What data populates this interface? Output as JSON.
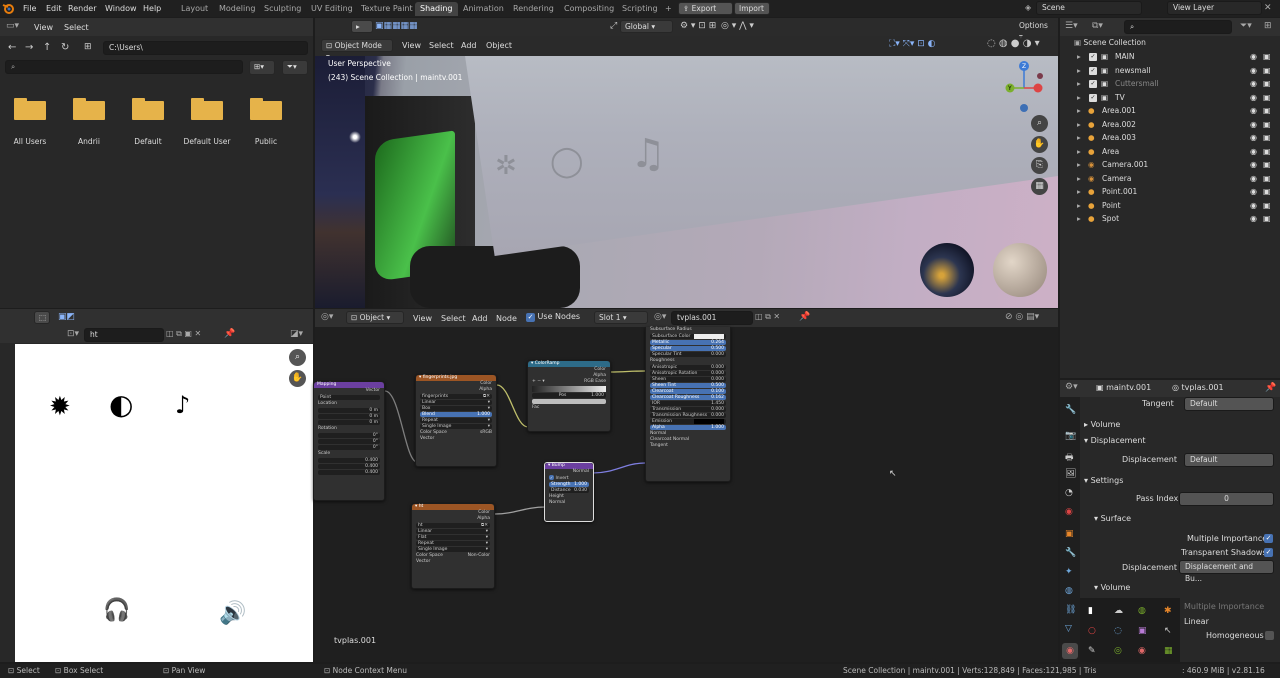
{
  "menubar": {
    "items": [
      "File",
      "Edit",
      "Render",
      "Window",
      "Help"
    ]
  },
  "workspaces": {
    "tabs": [
      "Layout",
      "Modeling",
      "Sculpting",
      "UV Editing",
      "Texture Paint",
      "Shading",
      "Animation",
      "Rendering",
      "Compositing",
      "Scripting"
    ],
    "active": "Shading"
  },
  "topright": {
    "export": "Export",
    "import": "Import",
    "scene": "Scene",
    "view_layer": "View Layer"
  },
  "file_browser": {
    "view": "View",
    "select": "Select",
    "path": "C:\\Users\\",
    "folders": [
      "All Users",
      "Andrii",
      "Default",
      "Default User",
      "Public"
    ],
    "folder_color": "#e6b34a"
  },
  "viewport": {
    "mode": "Object Mode",
    "menus": [
      "View",
      "Select",
      "Add",
      "Object"
    ],
    "orientation": "Global",
    "options": "Options",
    "overlay_title": "User Perspective",
    "overlay_subtitle": "(243) Scene Collection | maintv.001",
    "gizmo": {
      "x": "X",
      "y": "Y",
      "z": "Z"
    }
  },
  "image_editor": {
    "image_name": "ht"
  },
  "node_editor": {
    "type": "Object",
    "menus": [
      "View",
      "Select",
      "Add",
      "Node"
    ],
    "use_nodes": "Use Nodes",
    "slot": "Slot 1",
    "material": "tvplas.001",
    "footer": "tvplas.001",
    "nodes": {
      "img1": {
        "title": "fingerprints.jpg",
        "outs": [
          "Color",
          "Alpha"
        ],
        "fields": [
          "fingerprints",
          "Linear",
          "Box",
          "Blend",
          "Repeat",
          "Single Image",
          "Color Space",
          "sRGB",
          "Vector"
        ],
        "blend_val": "1.000"
      },
      "img2": {
        "title": "ht",
        "outs": [
          "Color",
          "Alpha"
        ],
        "fields": [
          "ht",
          "Linear",
          "Flat",
          "Repeat",
          "Single Image",
          "Color Space",
          "Non-Color",
          "Vector"
        ]
      },
      "colorramp": {
        "title": "ColorRamp",
        "outs": [
          "Color",
          "Alpha"
        ],
        "fields": [
          "RGB",
          "Ease",
          "Pos",
          "1.000",
          "Fac"
        ]
      },
      "bump": {
        "title": "Bump",
        "outs": [
          "Normal"
        ],
        "fields": [
          "Invert",
          "Strength",
          "1.000",
          "Distance",
          "0.030",
          "Height",
          "Normal"
        ]
      },
      "mapping": {
        "title": "Mapping",
        "outs": [
          "Vector"
        ],
        "fields": [
          "Point",
          "Location",
          "Rotation",
          "Scale"
        ],
        "vals": [
          "0 m",
          "0 m",
          "0 m",
          "0°",
          "0°",
          "0°",
          "0.400",
          "0.400",
          "0.400"
        ]
      },
      "principled": {
        "rows": [
          [
            "Subsurface Radius",
            ""
          ],
          [
            "Subsurface Color",
            ""
          ],
          [
            "Metallic",
            "0.264"
          ],
          [
            "Specular",
            "0.500"
          ],
          [
            "Specular Tint",
            "0.000"
          ],
          [
            "Roughness",
            ""
          ],
          [
            "Anisotropic",
            "0.000"
          ],
          [
            "Anisotropic Rotation",
            "0.000"
          ],
          [
            "Sheen",
            "0.000"
          ],
          [
            "Sheen Tint",
            "0.500"
          ],
          [
            "Clearcoat",
            "0.100"
          ],
          [
            "Clearcoat Roughness",
            "0.162"
          ],
          [
            "IOR",
            "1.450"
          ],
          [
            "Transmission",
            "0.000"
          ],
          [
            "Transmission Roughness",
            "0.000"
          ],
          [
            "Emission",
            ""
          ],
          [
            "Alpha",
            "1.000"
          ],
          [
            "Normal",
            ""
          ],
          [
            "Clearcoat Normal",
            ""
          ],
          [
            "Tangent",
            ""
          ]
        ]
      }
    }
  },
  "outliner": {
    "root": "Scene Collection",
    "items": [
      {
        "name": "MAIN",
        "type": "collection"
      },
      {
        "name": "newsmall",
        "type": "collection"
      },
      {
        "name": "Cuttersmall",
        "type": "collection"
      },
      {
        "name": "TV",
        "type": "collection"
      },
      {
        "name": "Area.001",
        "type": "light"
      },
      {
        "name": "Area.002",
        "type": "light"
      },
      {
        "name": "Area.003",
        "type": "light"
      },
      {
        "name": "Area",
        "type": "light"
      },
      {
        "name": "Camera.001",
        "type": "camera"
      },
      {
        "name": "Camera",
        "type": "camera"
      },
      {
        "name": "Point.001",
        "type": "light"
      },
      {
        "name": "Point",
        "type": "light"
      },
      {
        "name": "Spot",
        "type": "light"
      }
    ]
  },
  "properties": {
    "object": "maintv.001",
    "material": "tvplas.001",
    "tangent_label": "Tangent",
    "tangent_val": "Default",
    "volume": "Volume",
    "displacement_section": "Displacement",
    "displacement_label": "Displacement",
    "displacement_val": "Default",
    "settings": "Settings",
    "pass_index_label": "Pass Index",
    "pass_index": "0",
    "surface": "Surface",
    "multiple_importance": "Multiple Importance",
    "transparent_shadows": "Transparent Shadows",
    "disp_method_label": "Displacement",
    "disp_method": "Displacement and Bu...",
    "volume2": "Volume",
    "vol_multiple_importance": "Multiple Importance",
    "interpolation": "Linear",
    "homogeneous": "Homogeneous"
  },
  "statusbar": {
    "select": "Select",
    "box_select": "Box Select",
    "pan": "Pan View",
    "context": "Node Context Menu",
    "stats": "Scene Collection | maintv.001 | Verts:128,849 | Faces:121,985 | Tris",
    "mem": ": 460.9 MiB | v2.81.16"
  }
}
